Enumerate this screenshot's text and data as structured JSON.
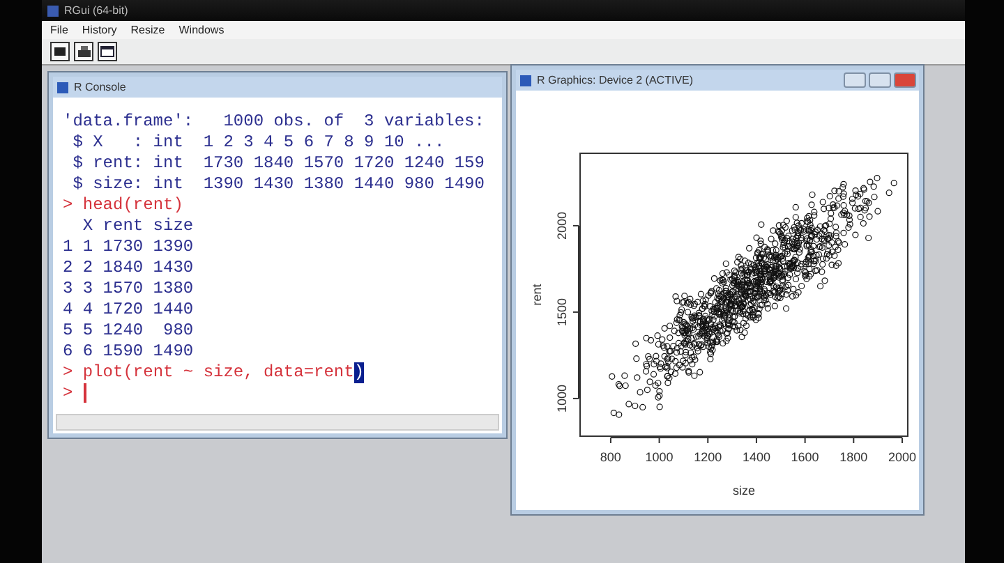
{
  "window": {
    "title": "RGui (64-bit)"
  },
  "menu": [
    "File",
    "History",
    "Resize",
    "Windows"
  ],
  "toolbar": [
    {
      "kind": "open"
    },
    {
      "kind": "print"
    },
    {
      "kind": "window"
    }
  ],
  "console": {
    "title": "R Console",
    "lines": [
      {
        "kind": "output",
        "text": "'data.frame':   1000 obs. of  3 variables:"
      },
      {
        "kind": "output",
        "text": " $ X   : int  1 2 3 4 5 6 7 8 9 10 ..."
      },
      {
        "kind": "output",
        "text": " $ rent: int  1730 1840 1570 1720 1240 159"
      },
      {
        "kind": "output",
        "text": " $ size: int  1390 1430 1380 1440 980 1490"
      },
      {
        "kind": "command",
        "prompt": ">",
        "text": "head(rent)"
      },
      {
        "kind": "output",
        "text": "  X rent size"
      },
      {
        "kind": "output",
        "text": "1 1 1730 1390"
      },
      {
        "kind": "output",
        "text": "2 2 1840 1430"
      },
      {
        "kind": "output",
        "text": "3 3 1570 1380"
      },
      {
        "kind": "output",
        "text": "4 4 1720 1440"
      },
      {
        "kind": "output",
        "text": "5 5 1240  980"
      },
      {
        "kind": "output",
        "text": "6 6 1590 1490"
      },
      {
        "kind": "command",
        "prompt": ">",
        "text": "plot(rent ~ size, data=rent",
        "selected_text": ")"
      },
      {
        "kind": "input",
        "prompt": ">"
      }
    ]
  },
  "graphics": {
    "title": "R Graphics: Device 2 (ACTIVE)",
    "plot": {
      "xlabel": "size",
      "ylabel": "rent",
      "xticks": [
        "800",
        "1000",
        "1200",
        "1400",
        "1600",
        "1800",
        "2000"
      ],
      "yticks": [
        "1000",
        "1500",
        "2000"
      ]
    }
  }
}
